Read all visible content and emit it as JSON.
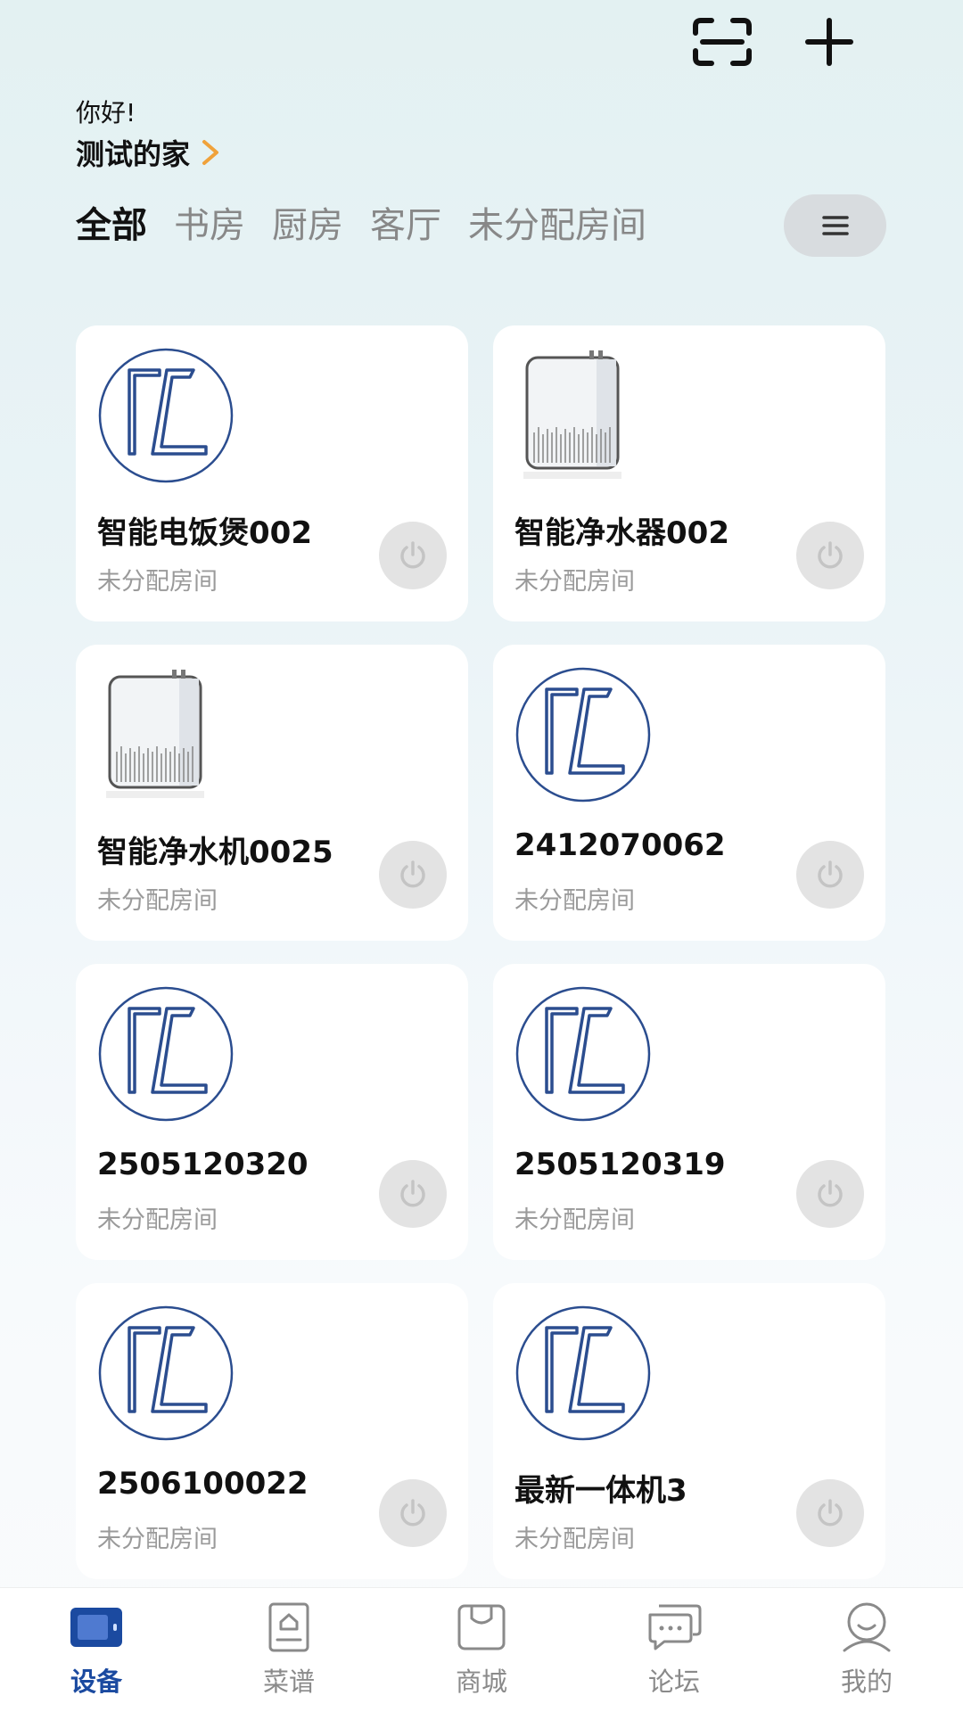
{
  "header": {
    "greeting": "你好!",
    "home_name": "测试的家"
  },
  "tabs": [
    {
      "label": "全部",
      "active": true
    },
    {
      "label": "书房",
      "active": false
    },
    {
      "label": "厨房",
      "active": false
    },
    {
      "label": "客厅",
      "active": false
    },
    {
      "label": "未分配房间",
      "active": false
    }
  ],
  "devices": [
    {
      "name": "智能电饭煲002",
      "room": "未分配房间",
      "icon": "brand-logo-icon"
    },
    {
      "name": "智能净水器002",
      "room": "未分配房间",
      "icon": "water-purifier-icon"
    },
    {
      "name": "智能净水机0025",
      "room": "未分配房间",
      "icon": "water-purifier-icon"
    },
    {
      "name": "2412070062",
      "room": "未分配房间",
      "icon": "brand-logo-icon"
    },
    {
      "name": "2505120320",
      "room": "未分配房间",
      "icon": "brand-logo-icon"
    },
    {
      "name": "2505120319",
      "room": "未分配房间",
      "icon": "brand-logo-icon"
    },
    {
      "name": "2506100022",
      "room": "未分配房间",
      "icon": "brand-logo-icon"
    },
    {
      "name": "最新一体机3",
      "room": "未分配房间",
      "icon": "brand-logo-icon"
    }
  ],
  "bottom_nav": [
    {
      "label": "设备",
      "icon": "device-icon",
      "active": true
    },
    {
      "label": "菜谱",
      "icon": "recipe-icon",
      "active": false
    },
    {
      "label": "商城",
      "icon": "shop-icon",
      "active": false
    },
    {
      "label": "论坛",
      "icon": "forum-icon",
      "active": false
    },
    {
      "label": "我的",
      "icon": "profile-icon",
      "active": false
    }
  ],
  "colors": {
    "accent": "#1b4aa0",
    "logo_blue": "#2b4d8f",
    "muted_text": "#9a9a9a"
  }
}
